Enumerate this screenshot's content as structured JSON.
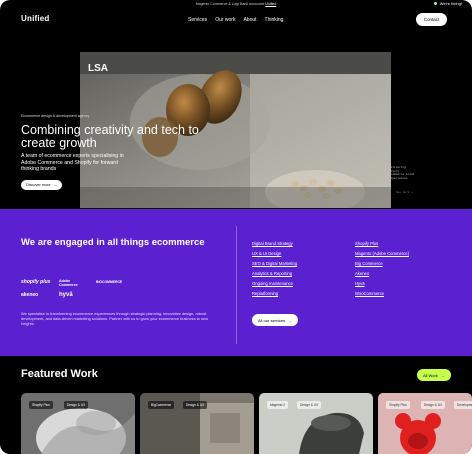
{
  "announcement": {
    "text": "Magento Commerce & Luigi Bank announce",
    "link": "Unified"
  },
  "status": {
    "label": "We're hiring!"
  },
  "header": {
    "logo": "Unified",
    "nav": [
      "Services",
      "Our work",
      "About",
      "Thinking"
    ],
    "contact": "Contact"
  },
  "hero": {
    "tag": "Ecommerce design & development agency",
    "title": "Combining creativity and tech to create growth",
    "subtitle": "A team of ecommerce experts specialising in Adobe Commerce and Shopify for forward thinking brands",
    "cta": "Discover more",
    "cta_icon": "arrow-right-icon",
    "image_logo": "LSA",
    "side_caption": "Delivering\nluxury\necommerce brand\nexperiences",
    "side_caption2": "See more +"
  },
  "engaged": {
    "title": "We are engaged in all things ecommerce",
    "description": "We specialise in transforming ecommerce experiences through strategic planning, innovative design, robust development, and data-driven marketing solutions. Partner with us to grow your ecommerce business to new heights.",
    "partner_logos": [
      "shopify plus",
      "Adobe Commerce",
      "BIGCOMMERCE",
      "akeneo",
      "hyvä"
    ],
    "services_left": [
      "Digital Brand Strategy",
      "UX & UI Design",
      "SEO & Digital Marketing",
      "Analytics & Reporting",
      "Ongoing maintenance",
      "Replatforming"
    ],
    "services_right": [
      "Shopify Plus",
      "Magento (Adobe Commerce)",
      "Big Commerce",
      "Akeneo",
      "Hyvä",
      "WooCommerce"
    ],
    "all_services": "All our services"
  },
  "featured": {
    "title": "Featured Work",
    "all_work": "All Work",
    "cards": [
      {
        "tags": [
          "Shopify Plus",
          "Design & UX"
        ]
      },
      {
        "tags": [
          "BigCommerce",
          "Design & UX"
        ]
      },
      {
        "tags": [
          "Magento 2",
          "Design & UX"
        ]
      },
      {
        "tags": [
          "Shopify Plus",
          "Design & UX",
          "Development"
        ]
      }
    ]
  },
  "colors": {
    "accent_purple": "#5b21d1",
    "accent_lime": "#c6ff4d",
    "hiring_dot": "#9ff28c"
  }
}
